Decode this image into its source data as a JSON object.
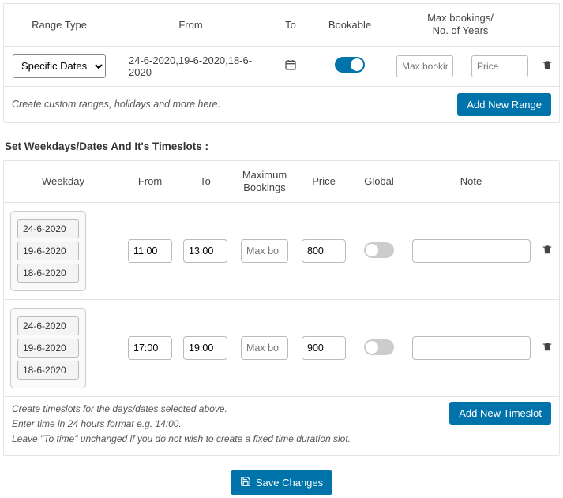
{
  "ranges": {
    "headers": {
      "range_type": "Range Type",
      "from": "From",
      "to": "To",
      "bookable": "Bookable",
      "max_years": "Max bookings/\nNo. of Years"
    },
    "row": {
      "select_value": "Specific Dates",
      "from_text": "24-6-2020,19-6-2020,18-6-2020",
      "bookable_on": true,
      "max_booking_placeholder": "Max booking",
      "price_placeholder": "Price"
    },
    "hint": "Create custom ranges, holidays and more here.",
    "add_btn": "Add New Range"
  },
  "section_title": "Set Weekdays/Dates And It's Timeslots :",
  "timeslots": {
    "headers": {
      "weekday": "Weekday",
      "from": "From",
      "to": "To",
      "max_bookings": "Maximum\nBookings",
      "price": "Price",
      "global": "Global",
      "note": "Note"
    },
    "rows": [
      {
        "dates": [
          "24-6-2020",
          "19-6-2020",
          "18-6-2020"
        ],
        "from": "11:00",
        "to": "13:00",
        "max_placeholder": "Max bo",
        "price": "800",
        "global_on": false,
        "note": ""
      },
      {
        "dates": [
          "24-6-2020",
          "19-6-2020",
          "18-6-2020"
        ],
        "from": "17:00",
        "to": "19:00",
        "max_placeholder": "Max bo",
        "price": "900",
        "global_on": false,
        "note": ""
      }
    ],
    "hints": [
      "Create timeslots for the days/dates selected above.",
      "Enter time in 24 hours format e.g. 14:00.",
      "Leave \"To time\" unchanged if you do not wish to create a fixed time duration slot."
    ],
    "add_btn": "Add New Timeslot"
  },
  "save_btn": "Save Changes",
  "icons": {
    "calendar": "📆",
    "trash": "🗑",
    "save": "💾"
  }
}
